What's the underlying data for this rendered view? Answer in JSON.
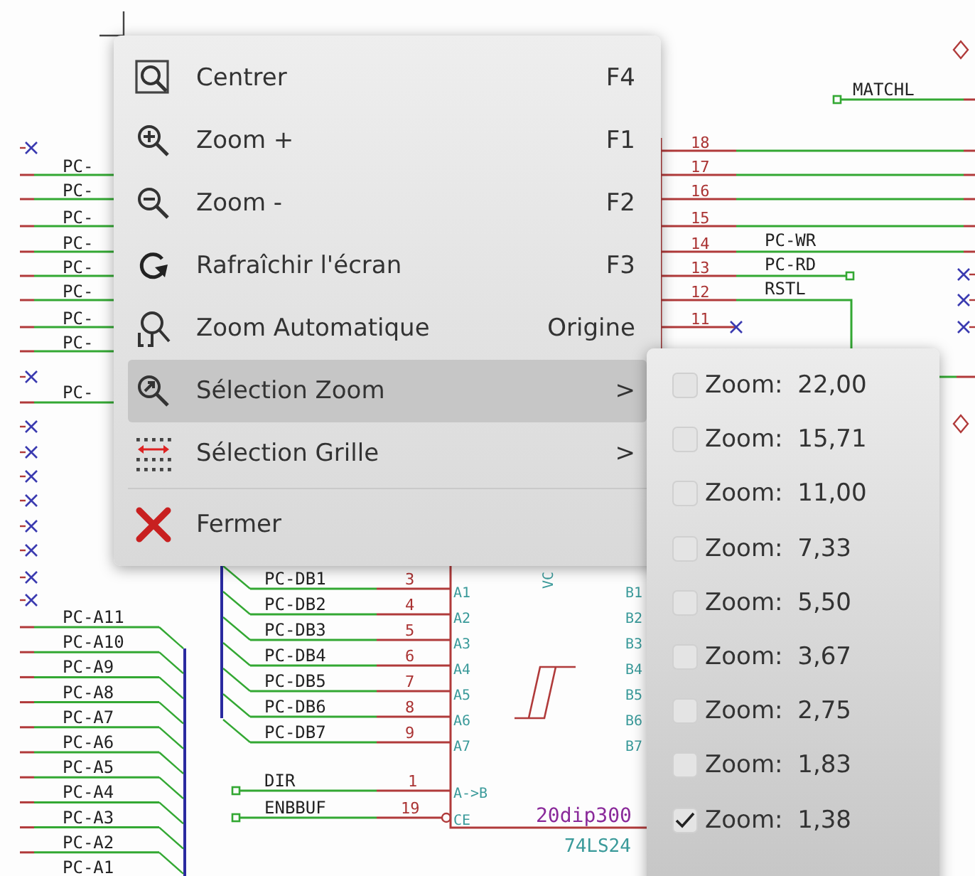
{
  "schematic": {
    "left_net_labels": [
      "PC-",
      "PC-",
      "PC-",
      "PC-",
      "PC-",
      "PC-",
      "PC-",
      "PC-"
    ],
    "left_single_label": "PC-",
    "address_labels": [
      "PC-A11",
      "PC-A10",
      "PC-A9",
      "PC-A8",
      "PC-A7",
      "PC-A6",
      "PC-A5",
      "PC-A4",
      "PC-A3",
      "PC-A2",
      "PC-A1"
    ],
    "data_nets": [
      {
        "label": "PC-DB1",
        "number": "3",
        "name": "A1"
      },
      {
        "label": "PC-DB2",
        "number": "4",
        "name": "A2"
      },
      {
        "label": "PC-DB3",
        "number": "5",
        "name": "A3"
      },
      {
        "label": "PC-DB4",
        "number": "6",
        "name": "A4"
      },
      {
        "label": "PC-DB5",
        "number": "7",
        "name": "A5"
      },
      {
        "label": "PC-DB6",
        "number": "8",
        "name": "A6"
      },
      {
        "label": "PC-DB7",
        "number": "9",
        "name": "A7"
      }
    ],
    "control_nets": [
      {
        "label": "DIR",
        "number": "1",
        "name": "A->B",
        "inverted": false
      },
      {
        "label": "ENBBUF",
        "number": "19",
        "name": "CE",
        "inverted": true
      }
    ],
    "b_pins": [
      "B1",
      "B2",
      "B3",
      "B4",
      "B5",
      "B6",
      "B7"
    ],
    "power_pin": "VC",
    "footprint": "20dip300",
    "part_value": "74LS24",
    "top_label": "MATCHL",
    "right_pins": [
      {
        "number": "18",
        "kind": "through"
      },
      {
        "number": "17",
        "kind": "through"
      },
      {
        "number": "16",
        "kind": "through"
      },
      {
        "number": "15",
        "kind": "through"
      },
      {
        "number": "14",
        "label": "PC-WR",
        "kind": "through"
      },
      {
        "number": "13",
        "label": "PC-RD",
        "kind": "square"
      },
      {
        "number": "12",
        "label": "RSTL",
        "kind": "bend"
      },
      {
        "number": "11",
        "kind": "noconnect"
      }
    ]
  },
  "context_menu": {
    "items": [
      {
        "kind": "center",
        "label": "Centrer",
        "shortcut": "F4",
        "selected": false,
        "separated": false
      },
      {
        "kind": "zoom-in",
        "label": "Zoom +",
        "shortcut": "F1",
        "selected": false,
        "separated": false
      },
      {
        "kind": "zoom-out",
        "label": "Zoom -",
        "shortcut": "F2",
        "selected": false,
        "separated": false
      },
      {
        "kind": "refresh",
        "label": "Rafraîchir l'écran",
        "shortcut": "F3",
        "selected": false,
        "separated": false
      },
      {
        "kind": "zoom-auto",
        "label": "Zoom Automatique",
        "shortcut": "Origine",
        "selected": false,
        "separated": false
      },
      {
        "kind": "zoom-select",
        "label": "Sélection Zoom",
        "arrow": ">",
        "selected": true,
        "separated": false
      },
      {
        "kind": "grid",
        "label": "Sélection Grille",
        "arrow": ">",
        "selected": false,
        "separated": false
      },
      {
        "kind": "close",
        "label": "Fermer",
        "selected": false,
        "separated": true
      }
    ]
  },
  "zoom_submenu": {
    "items": [
      {
        "label": "Zoom: 22,00",
        "checked": false
      },
      {
        "label": "Zoom: 15,71",
        "checked": false
      },
      {
        "label": "Zoom: 11,00",
        "checked": false
      },
      {
        "label": "Zoom: 7,33",
        "checked": false
      },
      {
        "label": "Zoom: 5,50",
        "checked": false
      },
      {
        "label": "Zoom: 3,67",
        "checked": false
      },
      {
        "label": "Zoom: 2,75",
        "checked": false
      },
      {
        "label": "Zoom: 1,83",
        "checked": false
      },
      {
        "label": "Zoom: 1,38",
        "checked": true
      }
    ]
  }
}
